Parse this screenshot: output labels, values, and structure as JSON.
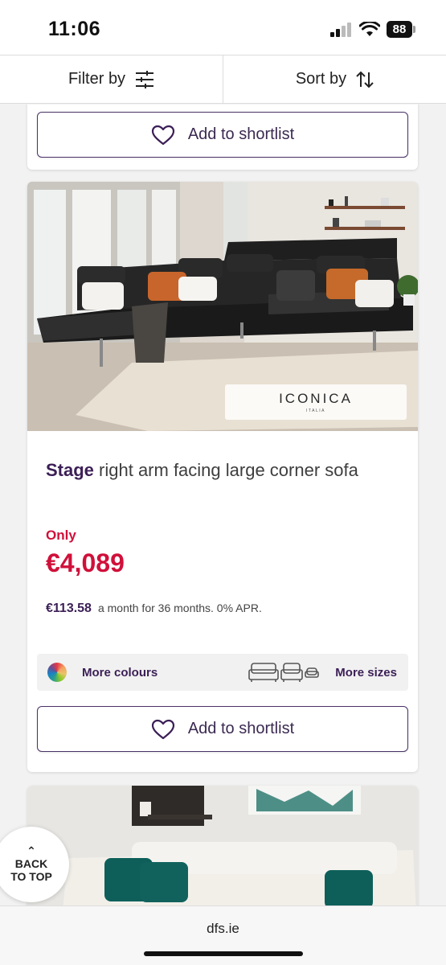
{
  "status_bar": {
    "time": "11:06",
    "battery": "88"
  },
  "filter_bar": {
    "filter_label": "Filter by",
    "sort_label": "Sort by"
  },
  "products": [
    {
      "shortlist_label": "Add to shortlist"
    },
    {
      "brand_badge": "ICONICA",
      "brand_sub": "ITALIA",
      "title_bold": "Stage",
      "title_rest": " right arm facing large corner sofa",
      "price_prefix": "Only",
      "price": "€4,089",
      "finance_amount": "€113.58",
      "finance_text": "a month for 36 months. 0% APR.",
      "more_colours_label": "More colours",
      "more_sizes_label": "More sizes",
      "shortlist_label": "Add to shortlist"
    }
  ],
  "back_to_top": {
    "line1": "BACK",
    "line2": "TO TOP"
  },
  "browser": {
    "url": "dfs.ie"
  },
  "colors": {
    "brand_purple": "#3b1f56",
    "price_red": "#d0103a",
    "background": "#f2f2f2"
  }
}
